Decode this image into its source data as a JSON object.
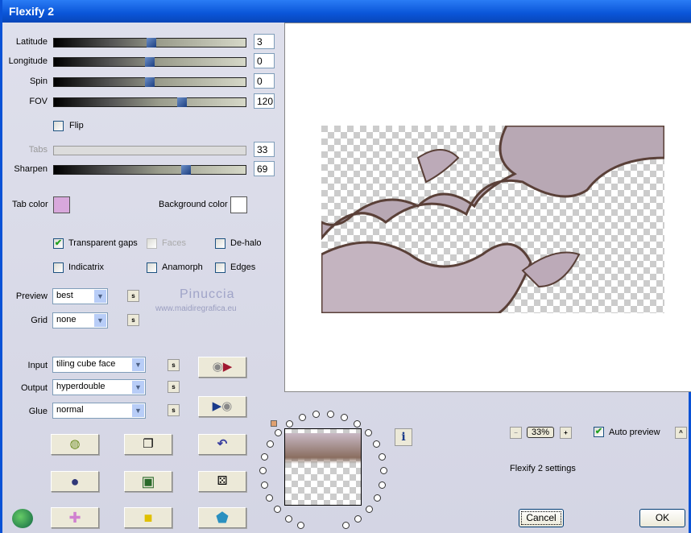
{
  "window": {
    "title": "Flexify 2"
  },
  "sliders": [
    {
      "label": "Latitude",
      "value": "3",
      "min": -180,
      "max": 180,
      "enabled": true
    },
    {
      "label": "Longitude",
      "value": "0",
      "min": -180,
      "max": 180,
      "enabled": true
    },
    {
      "label": "Spin",
      "value": "0",
      "min": -180,
      "max": 180,
      "enabled": true
    },
    {
      "label": "FOV",
      "value": "120",
      "min": 0,
      "max": 180,
      "enabled": true
    },
    {
      "label": "Tabs",
      "value": "33",
      "min": 0,
      "max": 100,
      "enabled": false
    },
    {
      "label": "Sharpen",
      "value": "69",
      "min": 0,
      "max": 100,
      "enabled": true
    }
  ],
  "flip": {
    "label": "Flip",
    "checked": false
  },
  "colors": {
    "tab_color_label": "Tab color",
    "tab_color": "#d8a8dc",
    "background_color_label": "Background color",
    "background_color": "#ffffff"
  },
  "options": [
    {
      "label": "Transparent gaps",
      "checked": true,
      "enabled": true
    },
    {
      "label": "Faces",
      "checked": false,
      "enabled": false
    },
    {
      "label": "De-halo",
      "checked": false,
      "enabled": true
    },
    {
      "label": "Indicatrix",
      "checked": false,
      "enabled": true
    },
    {
      "label": "Anamorph",
      "checked": false,
      "enabled": true
    },
    {
      "label": "Edges",
      "checked": false,
      "enabled": true
    }
  ],
  "preview_select": {
    "label": "Preview",
    "value": "best"
  },
  "grid_select": {
    "label": "Grid",
    "value": "none"
  },
  "watermark": {
    "name": "Pinuccia",
    "url": "www.maidiregrafica.eu"
  },
  "input_select": {
    "label": "Input",
    "value": "tiling cube face"
  },
  "output_select": {
    "label": "Output",
    "value": "hyperdouble"
  },
  "glue_select": {
    "label": "Glue",
    "value": "normal"
  },
  "s_label": "s",
  "zoom": {
    "minus": "−",
    "value": "33%",
    "plus": "+"
  },
  "auto_preview": {
    "label": "Auto preview",
    "checked": true
  },
  "collapse_label": "^",
  "settings_text": "Flexify 2 settings",
  "cancel_label": "Cancel",
  "ok_label": "OK",
  "info_label": "i"
}
